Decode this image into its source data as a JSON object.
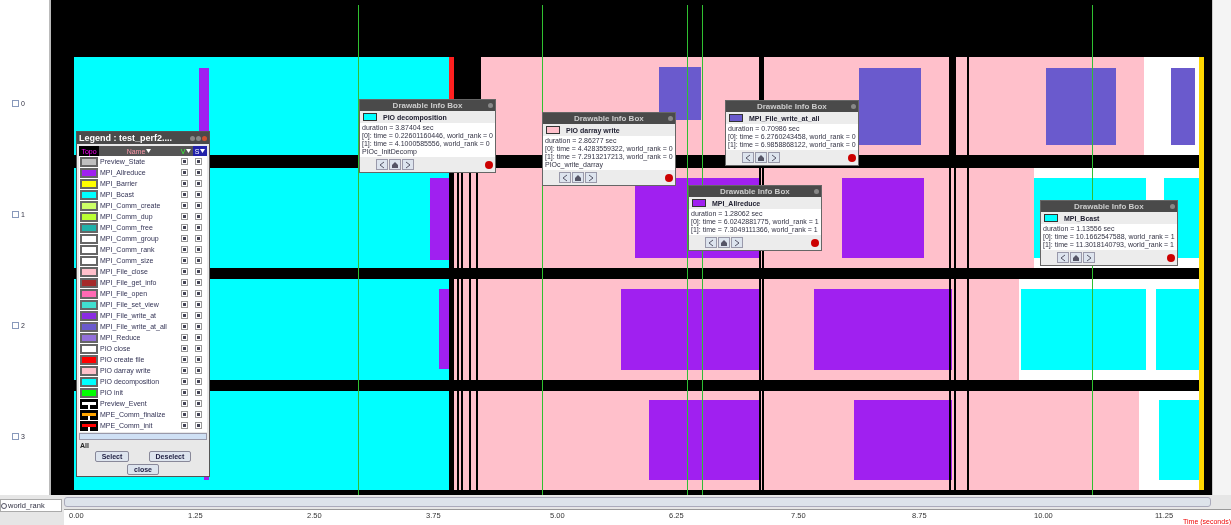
{
  "ranks": [
    {
      "label": "0"
    },
    {
      "label": "1"
    },
    {
      "label": "2"
    },
    {
      "label": "3"
    }
  ],
  "rank_selector": {
    "value": "world_rank"
  },
  "axis": {
    "ticks": [
      "0.00",
      "1.25",
      "2.50",
      "3.75",
      "5.00",
      "6.25",
      "7.50",
      "8.75",
      "10.00",
      "11.25"
    ],
    "label": "Time (seconds)"
  },
  "legend": {
    "title": "Legend : test_perf2....",
    "columns": [
      "Topo",
      "Name",
      "V",
      "S"
    ],
    "items": [
      {
        "name": "Preview_State",
        "color": "#c0c0c0",
        "kind": "state",
        "v_checked": true,
        "s_checked": true
      },
      {
        "name": "MPI_Allreduce",
        "color": "#a020f0",
        "kind": "state",
        "v_checked": true,
        "s_checked": true
      },
      {
        "name": "MPI_Barrier",
        "color": "#ffff00",
        "kind": "state",
        "v_checked": true,
        "s_checked": true
      },
      {
        "name": "MPI_Bcast",
        "color": "#00ffff",
        "kind": "state",
        "v_checked": true,
        "s_checked": true
      },
      {
        "name": "MPI_Comm_create",
        "color": "#ccff66",
        "kind": "state",
        "v_checked": true,
        "s_checked": true
      },
      {
        "name": "MPI_Comm_dup",
        "color": "#bbff33",
        "kind": "state",
        "v_checked": true,
        "s_checked": true
      },
      {
        "name": "MPI_Comm_free",
        "color": "#20b2aa",
        "kind": "state",
        "v_checked": true,
        "s_checked": true
      },
      {
        "name": "MPI_Comm_group",
        "color": "#ffffff",
        "kind": "state",
        "v_checked": true,
        "s_checked": true
      },
      {
        "name": "MPI_Comm_rank",
        "color": "#ffffff",
        "kind": "state",
        "v_checked": true,
        "s_checked": true
      },
      {
        "name": "MPI_Comm_size",
        "color": "#ffffff",
        "kind": "state",
        "v_checked": true,
        "s_checked": true
      },
      {
        "name": "MPI_File_close",
        "color": "#ffc0cb",
        "kind": "state",
        "v_checked": true,
        "s_checked": true
      },
      {
        "name": "MPI_File_get_info",
        "color": "#a52a2a",
        "kind": "state",
        "v_checked": true,
        "s_checked": true
      },
      {
        "name": "MPI_File_open",
        "color": "#ff69b4",
        "kind": "state",
        "v_checked": true,
        "s_checked": true
      },
      {
        "name": "MPI_File_set_view",
        "color": "#40e0d0",
        "kind": "state",
        "v_checked": true,
        "s_checked": true
      },
      {
        "name": "MPI_File_write_at",
        "color": "#8a2be2",
        "kind": "state",
        "v_checked": true,
        "s_checked": true
      },
      {
        "name": "MPI_File_write_at_all",
        "color": "#6a5acd",
        "kind": "state",
        "v_checked": true,
        "s_checked": true
      },
      {
        "name": "MPI_Reduce",
        "color": "#9370db",
        "kind": "state",
        "v_checked": true,
        "s_checked": true
      },
      {
        "name": "PIO close",
        "color": "#ffffff",
        "kind": "state",
        "v_checked": true,
        "s_checked": true
      },
      {
        "name": "PIO create file",
        "color": "#ff0000",
        "kind": "state",
        "v_checked": true,
        "s_checked": true
      },
      {
        "name": "PIO darray write",
        "color": "#ffc0cb",
        "kind": "state",
        "v_checked": true,
        "s_checked": true
      },
      {
        "name": "PIO decomposition",
        "color": "#00ffff",
        "kind": "state",
        "v_checked": true,
        "s_checked": true
      },
      {
        "name": "PIO init",
        "color": "#00ff00",
        "kind": "state",
        "v_checked": true,
        "s_checked": true
      },
      {
        "name": "Preview_Event",
        "color": "#ffffff",
        "kind": "event",
        "v_checked": true,
        "s_checked": true
      },
      {
        "name": "MPE_Comm_finalize",
        "color": "#ffa500",
        "kind": "event",
        "v_checked": true,
        "s_checked": true
      },
      {
        "name": "MPE_Comm_init",
        "color": "#ff0000",
        "kind": "event",
        "v_checked": true,
        "s_checked": true
      }
    ],
    "all_label": "All",
    "buttons": [
      "Select",
      "Deselect"
    ],
    "close_button": "close"
  },
  "info_boxes": [
    {
      "title": "Drawable Info Box",
      "name": "PIO decomposition",
      "color": "#00ffff",
      "lines": [
        "duration = 3.87404 sec",
        "[0]: time = 0.22601160446, world_rank = 0",
        "[1]: time = 4.1000585556, world_rank = 0",
        "PIOc_InitDecomp"
      ]
    },
    {
      "title": "Drawable Info Box",
      "name": "PIO darray write",
      "color": "#ffc0cb",
      "lines": [
        "duration = 2.86277 sec",
        "[0]: time = 4.4283559322, world_rank = 0",
        "[1]: time = 7.2913217213, world_rank = 0",
        "PIOc_write_darray"
      ]
    },
    {
      "title": "Drawable Info Box",
      "name": "MPI_File_write_at_all",
      "color": "#6a5acd",
      "lines": [
        "duration = 0.70986 sec",
        "[0]: time = 6.2760243458, world_rank = 0",
        "[1]: time = 6.9858868122, world_rank = 0"
      ]
    },
    {
      "title": "Drawable Info Box",
      "name": "MPI_Allreduce",
      "color": "#a020f0",
      "lines": [
        "duration = 1.28062 sec",
        "[0]: time = 6.0242881775, world_rank = 1",
        "[1]: time = 7.3049111366, world_rank = 1"
      ]
    },
    {
      "title": "Drawable Info Box",
      "name": "MPI_Bcast",
      "color": "#00ffff",
      "lines": [
        "duration = 1.13556 sec",
        "[0]: time = 10.1662547588, world_rank = 1",
        "[1]: time = 11.3018140793, world_rank = 1"
      ]
    }
  ]
}
